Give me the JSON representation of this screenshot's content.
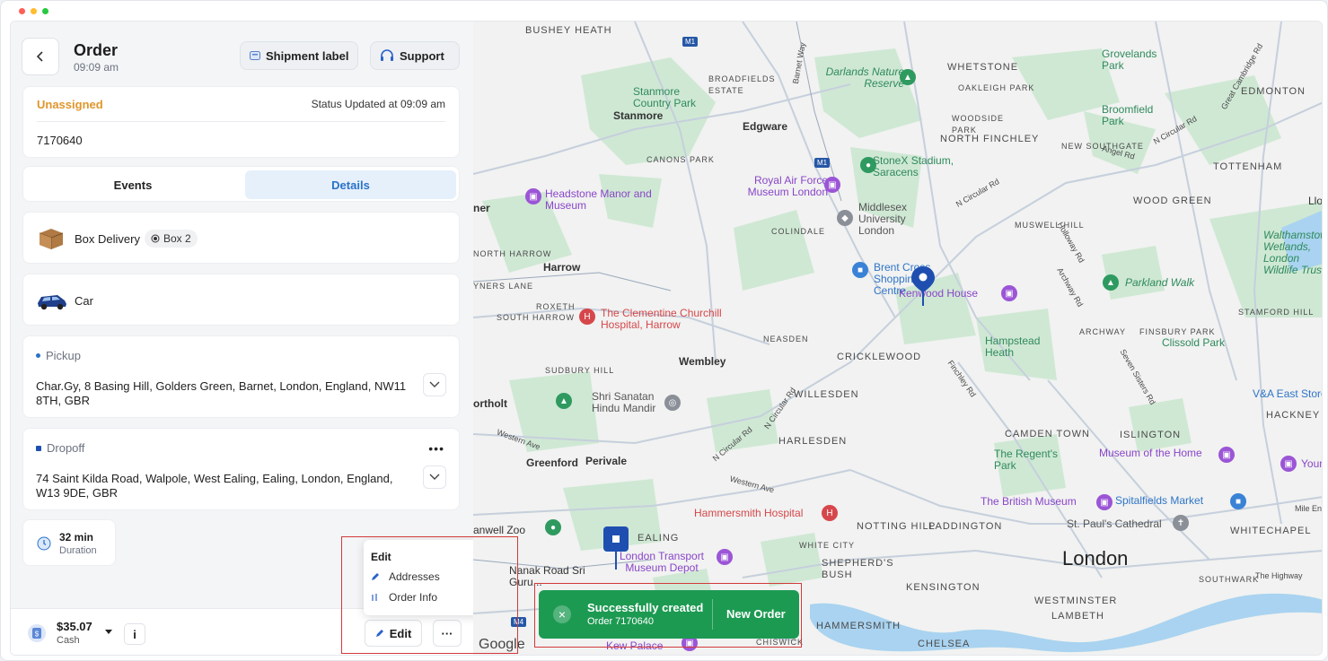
{
  "colors": {
    "accent": "#1e4fb0",
    "status_unassigned": "#e0962c",
    "success": "#1d9a52",
    "tab_active_bg": "#e6f0fb",
    "tab_active_text": "#2a72c9"
  },
  "header": {
    "title": "Order",
    "time": "09:09 am",
    "shipment_label": "Shipment label",
    "support": "Support"
  },
  "status": {
    "label": "Unassigned",
    "updated": "Status Updated at 09:09 am",
    "order_number": "7170640"
  },
  "tabs": [
    {
      "label": "Events",
      "active": false
    },
    {
      "label": "Details",
      "active": true
    }
  ],
  "package": {
    "type": "Box Delivery",
    "chip": "Box 2"
  },
  "vehicle": {
    "type": "Car"
  },
  "pickup": {
    "label": "Pickup",
    "address": "Char.Gy, 8 Basing Hill, Golders Green, Barnet, London, England, NW11 8TH, GBR"
  },
  "dropoff": {
    "label": "Dropoff",
    "address": "74 Saint Kilda Road, Walpole, West Ealing, Ealing, London, England, W13 9DE, GBR",
    "more": "•••"
  },
  "duration": {
    "value": "32 min",
    "label": "Duration"
  },
  "footer": {
    "price": "$35.07",
    "method": "Cash",
    "info": "i",
    "edit": "Edit",
    "more": "···"
  },
  "edit_menu": {
    "title": "Edit",
    "items": [
      "Addresses",
      "Order Info"
    ]
  },
  "toast": {
    "title": "Successfully created",
    "subtitle": "Order 7170640",
    "action": "New Order",
    "close": "×"
  },
  "map": {
    "attribution": "Google",
    "labels": {
      "bushey_heath": "BUSHEY HEATH",
      "broadfields": "BROADFIELDS ESTATE",
      "stanmore_cp": "Stanmore Country Park",
      "stanmore": "Stanmore",
      "darlands": "Darlands Nature Reserve",
      "whetstone": "WHETSTONE",
      "oakleigh": "OAKLEIGH PARK",
      "grovelands": "Grovelands Park",
      "edmonton": "EDMONTON",
      "woodside": "WOODSIDE PARK",
      "north_finchley": "NORTH FINCHLEY",
      "broomfield": "Broomfield Park",
      "new_southgate": "NEW SOUTHGATE",
      "edgware": "Edgware",
      "canons": "CANONS PARK",
      "stonex": "StoneX Stadium, Saracens",
      "tottenham": "TOTTENHAM",
      "raf_museum": "Royal Air Force Museum London",
      "headstone": "Headstone Manor and Museum",
      "middlesex": "Middlesex University London",
      "wood_green": "WOOD GREEN",
      "colindale": "COLINDALE",
      "muswell": "MUSWELL HILL",
      "walthamstow": "Walthamstow Wetlands, London Wildlife Trust",
      "north_harrow": "NORTH HARROW",
      "harrow": "Harrow",
      "brent_cross": "Brent Cross Shopping Centre",
      "kenwood": "Kenwood House",
      "parkland": "Parkland Walk",
      "rayners": "YNERS LANE",
      "roxeth": "ROXETH",
      "south_harrow": "SOUTH HARROW",
      "clementine": "The Clementine Churchill Hospital, Harrow",
      "stamford": "STAMFORD HILL",
      "archway": "ARCHWAY",
      "finsbury_park": "FINSBURY PARK",
      "neasden": "NEASDEN",
      "hampstead": "Hampstead Heath",
      "clissold": "Clissold Park",
      "sudbury": "SUDBURY HILL",
      "wembley": "Wembley",
      "cricklewood": "CRICKLEWOOD",
      "northolt": "ortholt",
      "shri": "Shri Sanatan Hindu Mandir",
      "willesden": "WILLESDEN",
      "va": "V&A East Storel",
      "hackney": "HACKNEY",
      "camden": "CAMDEN TOWN",
      "islington": "ISLINGTON",
      "harlesden": "HARLESDEN",
      "greenford": "Greenford",
      "perivale": "Perivale",
      "regents": "The Regent's Park",
      "museum_home": "Museum of the Home",
      "hammersmith_h": "Hammersmith Hospital",
      "british_museum": "The British Museum",
      "spitalfields": "Spitalfields Market",
      "hanwell": "anwell Zoo",
      "notting": "NOTTING HILL",
      "paddington": "PADDINGTON",
      "st_pauls": "St. Paul's Cathedral",
      "whitechapel": "WHITECHAPEL",
      "ealing": "EALING",
      "white_city": "WHITE CITY",
      "transport": "London Transport Museum Depot",
      "shepherds": "SHEPHERD'S BUSH",
      "london": "London",
      "nanak": "Nanak Road Sri Guru...",
      "kensington": "KENSINGTON",
      "southwark": "SOUTHWARK",
      "westminster": "WESTMINSTER",
      "hammersmith": "HAMMERSMITH",
      "lambeth": "LAMBETH",
      "chelsea": "CHELSEA",
      "chiswick": "CHISWICK",
      "kew": "Kew Palace",
      "lloyd": "Lloy",
      "young": "Youn",
      "jubilee": "Mile End",
      "highway": "The Highway",
      "m1": "M1",
      "m1b": "M1",
      "m4": "M4"
    },
    "roads": {
      "barnet_way": "Barnet Way",
      "n_circular_1": "N Circular Rd",
      "n_circular_2": "N Circular Rd",
      "n_circular_3": "N Circular Rd",
      "finchley": "Finchley Rd",
      "archway_rd": "Archway Rd",
      "angel": "Angel Rd",
      "western": "Western Ave",
      "western2": "Western Ave",
      "cambridge": "Great Cambridge Rd",
      "n_circ_east": "N Circular Rd",
      "seven_sisters": "Seven Sisters Rd",
      "holloway": "Holloway Rd"
    }
  }
}
